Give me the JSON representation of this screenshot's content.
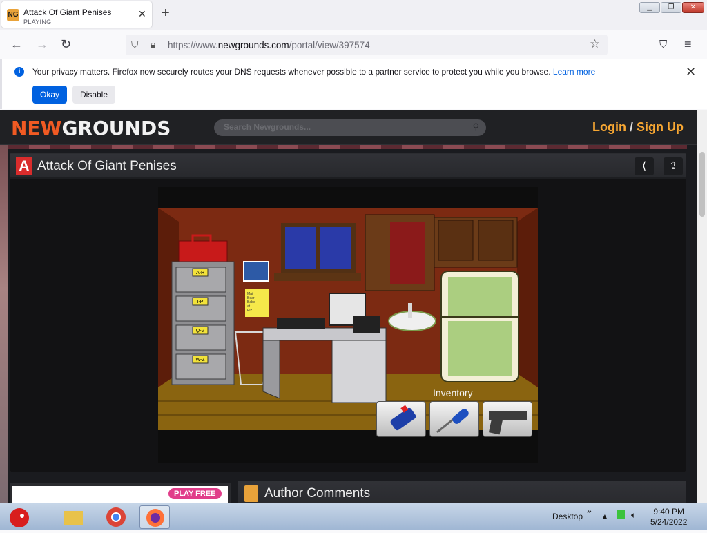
{
  "browser": {
    "tab_title": "Attack Of Giant Penises",
    "tab_status": "PLAYING",
    "tab_favicon": "NG",
    "url_prefix": "https://www.",
    "url_domain": "newgrounds.com",
    "url_path": "/portal/view/397574"
  },
  "notification": {
    "text": "Your privacy matters. Firefox now securely routes your DNS requests whenever possible to a partner service to protect you while you browse.",
    "link": "Learn more",
    "okay": "Okay",
    "disable": "Disable"
  },
  "site": {
    "logo_new": "NEW",
    "logo_grounds": "GROUNDS",
    "search_placeholder": "Search Newgrounds...",
    "login": "Login",
    "separator": "/",
    "signup": "Sign Up",
    "accent": "#f7a733"
  },
  "game": {
    "badge": "A",
    "title": "Attack Of Giant Penises",
    "inventory_label": "Inventory",
    "drawer_labels": [
      "A-H",
      "I-P",
      "Q-V",
      "W-Z"
    ],
    "sticky_note": "Mail Bear Babe at Piz"
  },
  "below": {
    "play_free": "PLAY FREE",
    "author_comments": "Author Comments"
  },
  "taskbar": {
    "desktop": "Desktop",
    "time": "9:40 PM",
    "date": "5/24/2022"
  }
}
